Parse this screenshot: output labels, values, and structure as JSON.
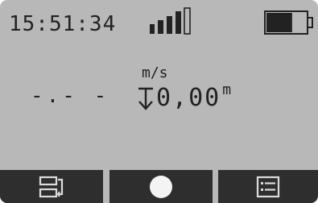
{
  "status_bar": {
    "clock": "15:51:34",
    "signal_level": 4,
    "signal_max": 5,
    "battery_level": 0.65
  },
  "readings": {
    "speed_unit": "m/s",
    "speed_value": "-.- -",
    "depth_value": "0,00",
    "depth_unit": "m",
    "depth_icon": "arrow-down-to-line-icon"
  },
  "toolbar": {
    "buttons": [
      {
        "icon": "switch-view-icon"
      },
      {
        "icon": "record-circle-icon"
      },
      {
        "icon": "list-menu-icon"
      }
    ]
  },
  "colors": {
    "screen_background": "#b8b8b8",
    "text": "#222222",
    "button_background": "#2e2e2e",
    "button_icon": "#dcdcdc",
    "record_icon": "#f4f4f4"
  }
}
